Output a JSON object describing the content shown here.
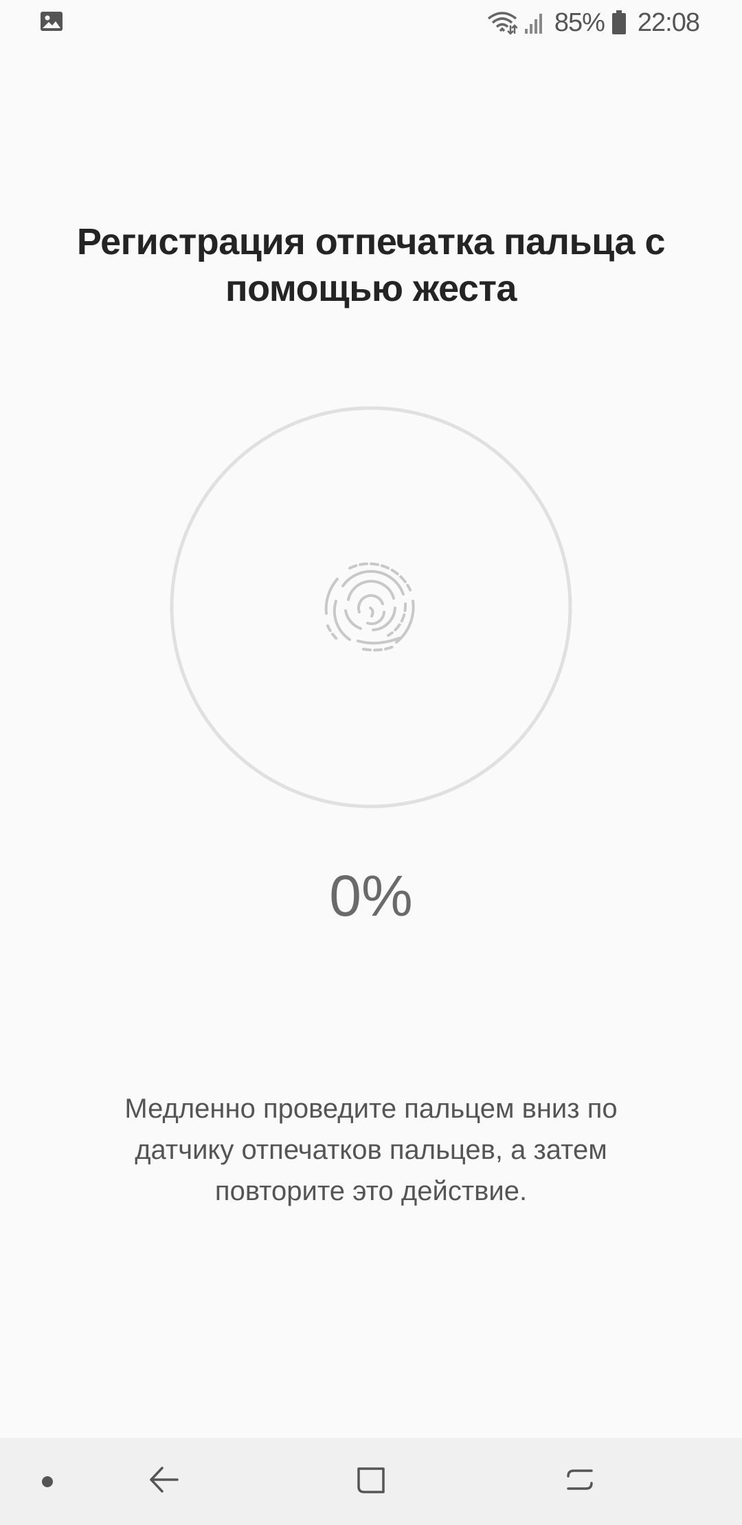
{
  "status_bar": {
    "notification_icon": "image-icon",
    "wifi_icon": "wifi-icon",
    "signal_icon": "signal-icon",
    "battery_percent": "85%",
    "battery_icon": "battery-icon",
    "time": "22:08"
  },
  "screen": {
    "title": "Регистрация отпечатка пальца с помощью жеста",
    "sensor_icon": "fingerprint-icon",
    "progress_text": "0%",
    "progress_value": 0,
    "instruction": "Медленно проведите пальцем вниз по датчику отпечатков пальцев, а затем повторите это действие."
  },
  "nav_bar": {
    "icons": [
      "dot-icon",
      "back-icon",
      "home-icon",
      "recents-icon"
    ]
  },
  "colors": {
    "background": "#fafafa",
    "ring": "#e0e0e0",
    "fingerprint": "#c8c8c8",
    "nav_background": "#f0f0f0"
  }
}
